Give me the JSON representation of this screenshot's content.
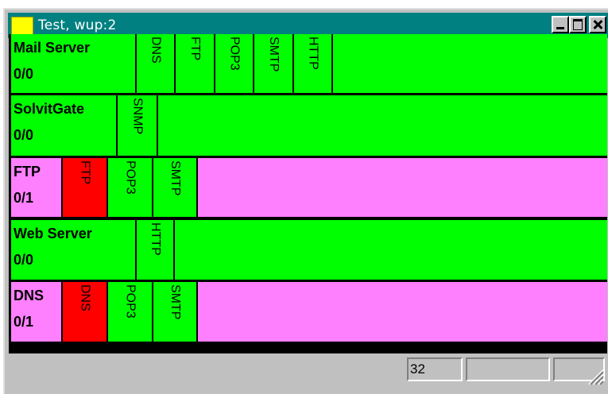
{
  "window": {
    "title": "Test, wup:2"
  },
  "colors": {
    "ok": "#00ff00",
    "warn": "#ff80ff",
    "down": "#ff0000",
    "titlebar": "#008080"
  },
  "hosts": [
    {
      "name": "Mail Server",
      "status": "0/0",
      "state": "ok",
      "services": [
        {
          "name": "DNS",
          "state": "ok"
        },
        {
          "name": "FTP",
          "state": "ok"
        },
        {
          "name": "POP3",
          "state": "ok"
        },
        {
          "name": "SMTP",
          "state": "ok"
        },
        {
          "name": "HTTP",
          "state": "ok"
        }
      ]
    },
    {
      "name": "SolvitGate",
      "status": "0/0",
      "state": "ok",
      "services": [
        {
          "name": "SNMP",
          "state": "ok"
        }
      ]
    },
    {
      "name": "FTP",
      "status": "0/1",
      "state": "warn",
      "services": [
        {
          "name": "FTP",
          "state": "down"
        },
        {
          "name": "POP3",
          "state": "ok"
        },
        {
          "name": "SMTP",
          "state": "ok"
        }
      ]
    },
    {
      "name": "Web Server",
      "status": "0/0",
      "state": "ok",
      "services": [
        {
          "name": "HTTP",
          "state": "ok"
        }
      ]
    },
    {
      "name": "DNS",
      "status": "0/1",
      "state": "warn",
      "services": [
        {
          "name": "DNS",
          "state": "down"
        },
        {
          "name": "POP3",
          "state": "ok"
        },
        {
          "name": "SMTP",
          "state": "ok"
        }
      ]
    }
  ],
  "statusbar": {
    "panel1": "32",
    "panel2": "",
    "panel3": ""
  }
}
